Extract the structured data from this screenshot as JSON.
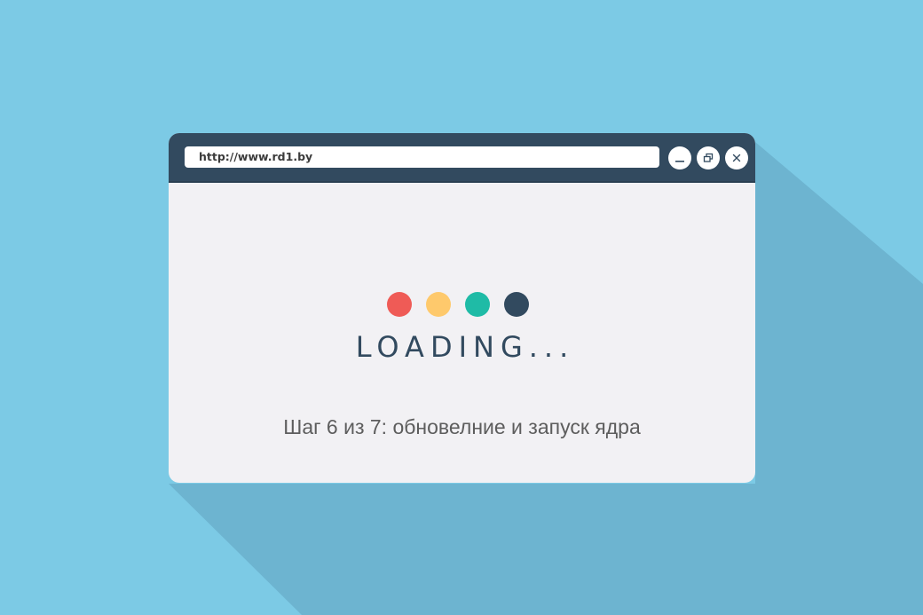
{
  "colors": {
    "background": "#7ccae5",
    "long_shadow": "#6db4d0",
    "titlebar": "#324a5f",
    "window_body": "#f2f1f4"
  },
  "browser": {
    "url": "http://www.rd1.by",
    "controls": {
      "minimize": "minimize-icon",
      "restore": "restore-icon",
      "close": "close-icon"
    }
  },
  "loader": {
    "dots": [
      {
        "color": "#ef5b56"
      },
      {
        "color": "#fec96c"
      },
      {
        "color": "#1fbba6"
      },
      {
        "color": "#324a5f"
      }
    ],
    "label": "LOADING...",
    "status": "Шаг 6 из 7: обновелние и запуск ядра"
  }
}
